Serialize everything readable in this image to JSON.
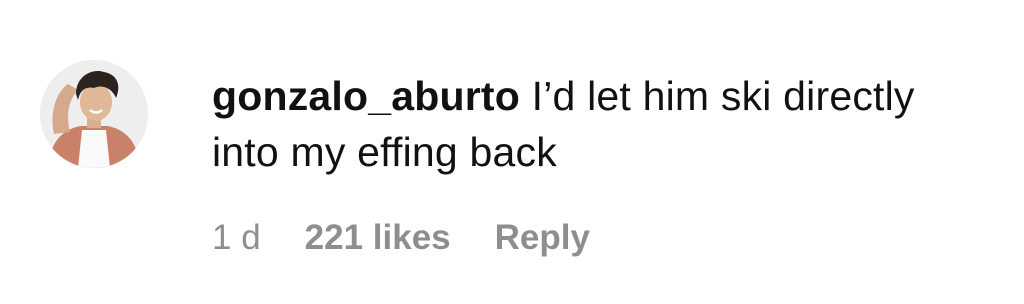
{
  "comment": {
    "username": "gonzalo_aburto",
    "text": "I’d let him ski directly into my effing back",
    "time": "1 d",
    "likes": "221 likes",
    "reply_label": "Reply"
  },
  "colors": {
    "text": "#111111",
    "meta": "#8e8e8e",
    "background": "#ffffff"
  },
  "icons": {
    "avatar": "profile-photo"
  }
}
